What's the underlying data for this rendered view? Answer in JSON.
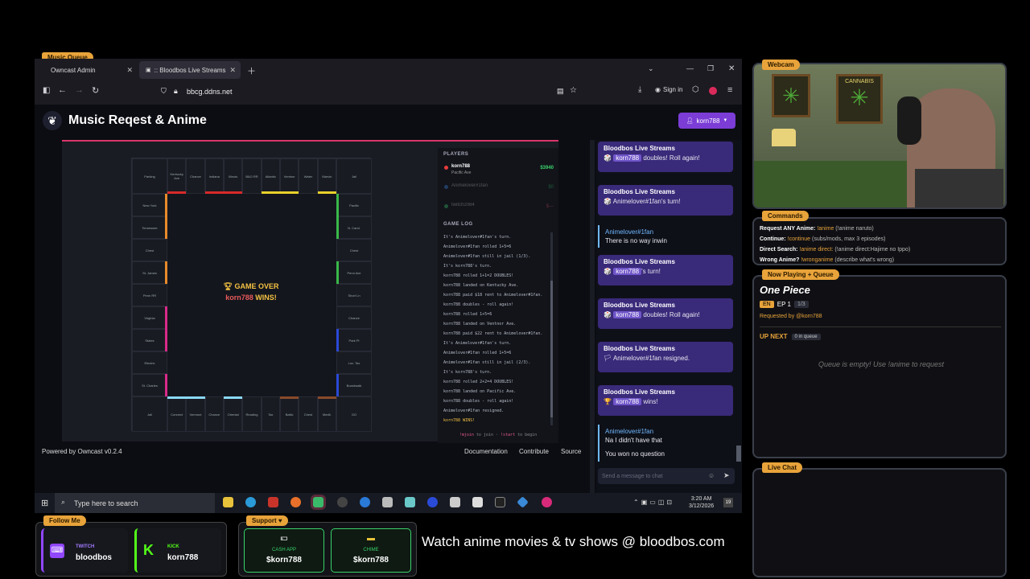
{
  "overlay": {
    "music_queue_tag": "Music Queue",
    "webcam_tag": "Webcam",
    "commands": {
      "tag": "Commands",
      "lines": [
        {
          "label": "Request ANY Anime:",
          "cmd": "!anime",
          "desc": "(!anime naruto)"
        },
        {
          "label": "Continue:",
          "cmd": "!continue",
          "desc": "(subs/mods, max 3 episodes)"
        },
        {
          "label": "Direct Search:",
          "cmd": "!anime direct:",
          "desc": "(!anime direct:Hajime no Ippo)"
        },
        {
          "label": "Wrong Anime?",
          "cmd": "!wronganime",
          "desc": "(describe what's wrong)"
        }
      ]
    },
    "now_playing": {
      "tag": "Now Playing + Queue",
      "title": "One Piece",
      "lang": "EN",
      "episode": "EP 1",
      "progress": "1/3",
      "requested_by": "Requested by @korn788",
      "up_next_label": "UP NEXT",
      "queue_count": "0 in queue",
      "empty_text": "Queue is empty! Use !anime to request"
    },
    "live_chat_tag": "Live Chat",
    "follow": {
      "tag": "Follow Me",
      "twitch_label": "TWITCH",
      "twitch_user": "bloodbos",
      "kick_label": "KICK",
      "kick_user": "korn788"
    },
    "support": {
      "tag": "Support",
      "cashapp_label": "CASH APP",
      "cashapp_user": "$korn788",
      "chime_label": "CHIME",
      "chime_user": "$korn788"
    },
    "promo": "Watch anime movies & tv shows @ bloodbos.com"
  },
  "browser": {
    "tabs": [
      {
        "label": "Owncast Admin"
      },
      {
        "label": ":: Bloodbos Live Streams"
      }
    ],
    "url": "bbcg.ddns.net",
    "sign_in": "Sign in"
  },
  "site": {
    "title": "Music Reqest & Anime",
    "user_button": "korn788",
    "footer": {
      "powered": "Powered by Owncast v0.2.4",
      "links": [
        "Documentation",
        "Contribute",
        "Source"
      ]
    }
  },
  "game": {
    "top_row": [
      "Parking",
      "Kentucky Ave",
      "Chance",
      "Indiana",
      "Illinois",
      "B&O RR",
      "Atlantic",
      "Ventnor",
      "Water",
      "Marvin",
      "Jail"
    ],
    "left_col": [
      "New York",
      "Tennessee",
      "Chest",
      "St. James",
      "Penn RR",
      "Virginia",
      "States",
      "Electric",
      "St. Charles"
    ],
    "right_col": [
      "Pacific",
      "N. Carol.",
      "Chest",
      "Penn Ave",
      "Short Ln",
      "Chance",
      "Park Pl",
      "Lux. Tax",
      "Boardwalk"
    ],
    "bottom_row": [
      "Jail",
      "Connect",
      "Vermont",
      "Chance",
      "Oriental",
      "Reading",
      "Tax",
      "Baltic",
      "Chest",
      "Medit.",
      "GO"
    ],
    "game_over": "GAME OVER",
    "winner": "korn788",
    "wins_label": "WINS!",
    "players_header": "PLAYERS",
    "players": [
      {
        "name": "korn788",
        "location": "Pacific Ave",
        "money": "$3940",
        "color": "#e83a3a"
      },
      {
        "name": "Animelover#1fan",
        "location": "",
        "money": "$0",
        "color": "#3a8ce8"
      },
      {
        "name": "twitch2084",
        "location": "",
        "money": "$—",
        "color": "#3ac86e"
      }
    ],
    "log_header": "GAME LOG",
    "log": [
      "It's Animelover#1fan's turn.",
      "Animelover#1fan rolled 1+5=6",
      "Animelover#1fan still in jail (1/3).",
      "It's korn788's turn.",
      "korn788 rolled 1+1=2 DOUBLES!",
      "korn788 landed on Kentucky Ave.",
      "korn788 paid $18 rent to Animelover#1fan.",
      "korn788 doubles - roll again!",
      "korn788 rolled 1+5=6",
      "korn788 landed on Ventnor Ave.",
      "korn788 paid $22 rent to Animelover#1fan.",
      "It's Animelover#1fan's turn.",
      "Animelover#1fan rolled 1+5=6",
      "Animelover#1fan still in jail (2/3).",
      "It's korn788's turn.",
      "korn788 rolled 2+2=4 DOUBLES!",
      "korn788 landed on Pacific Ave.",
      "korn788 doubles - roll again!",
      "Animelover#1fan resigned.",
      "korn788 WINS!"
    ],
    "hint": {
      "cmd1": "!mjoin",
      "text1": "to join ·",
      "cmd2": "!start",
      "text2": "to begin"
    }
  },
  "chat": {
    "messages": [
      {
        "type": "system",
        "title": "Bloodbos Live Streams",
        "icon": "🎲",
        "user": "korn788",
        "text": "doubles! Roll again!"
      },
      {
        "type": "system",
        "title": "Bloodbos Live Streams",
        "icon": "🎲",
        "user": "",
        "text": "Animelover#1fan's turn!"
      },
      {
        "type": "user",
        "user": "Animelover#1fan",
        "text": "There is no way inwin"
      },
      {
        "type": "system",
        "title": "Bloodbos Live Streams",
        "icon": "🎲",
        "user": "korn788",
        "text": "'s turn!"
      },
      {
        "type": "system",
        "title": "Bloodbos Live Streams",
        "icon": "🎲",
        "user": "korn788",
        "text": "doubles! Roll again!"
      },
      {
        "type": "system",
        "title": "Bloodbos Live Streams",
        "icon": "🏳",
        "user": "",
        "text": "Animelover#1fan resigned."
      },
      {
        "type": "system",
        "title": "Bloodbos Live Streams",
        "icon": "🏆",
        "user": "korn788",
        "text": "wins!"
      },
      {
        "type": "user",
        "user": "Animelover#1fan",
        "text": "Na I didn't have that",
        "text2": "You won no question"
      }
    ],
    "input_placeholder": "Send a message to chat"
  },
  "taskbar": {
    "search_placeholder": "Type here to search",
    "time": "3:20 AM",
    "date": "3/12/2026",
    "notif_count": "19"
  },
  "colors": {
    "accent_purple": "#7b3dd6",
    "orange_tag": "#e8a33a",
    "game_red": "#d8366a"
  }
}
